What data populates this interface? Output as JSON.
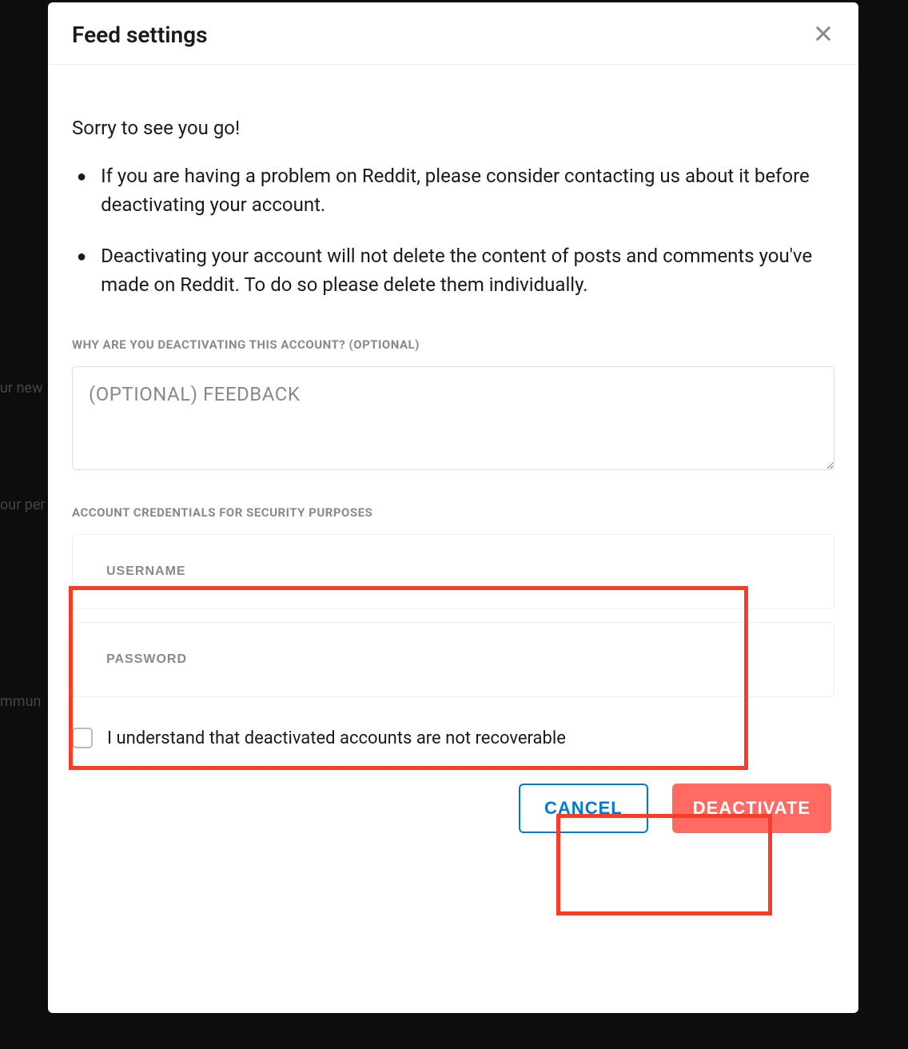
{
  "modal": {
    "title": "Feed settings",
    "intro": "Sorry to see you go!",
    "bullets": [
      "If you are having a problem on Reddit, please consider contacting us about it before deactivating your account.",
      "Deactivating your account will not delete the content of posts and comments you've made on Reddit. To do so please delete them individually."
    ],
    "feedback": {
      "label": "WHY ARE YOU DEACTIVATING THIS ACCOUNT? (OPTIONAL)",
      "placeholder": "(OPTIONAL) FEEDBACK"
    },
    "credentials": {
      "label": "ACCOUNT CREDENTIALS FOR SECURITY PURPOSES",
      "username_placeholder": "USERNAME",
      "password_placeholder": "PASSWORD"
    },
    "checkbox_label": "I understand that deactivated accounts are not recoverable",
    "buttons": {
      "cancel": "CANCEL",
      "deactivate": "DEACTIVATE"
    }
  },
  "background": {
    "line1": "ur new",
    "line2": "our per",
    "line3": "mmun"
  }
}
